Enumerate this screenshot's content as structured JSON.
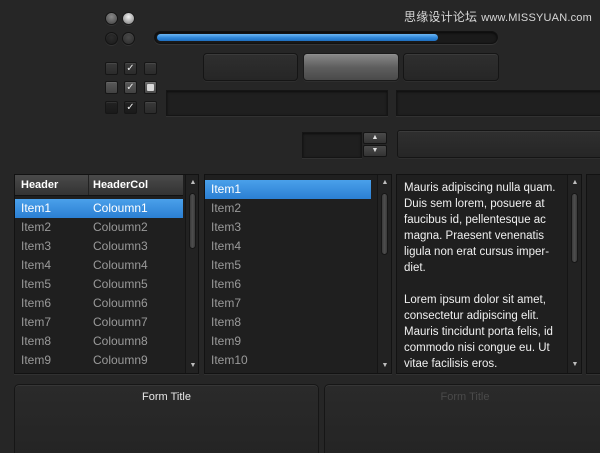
{
  "watermark": {
    "cn": "思缘设计论坛",
    "site": "www.MISSYUAN.com"
  },
  "progress": {
    "value": 0.83
  },
  "icons": {
    "check": "✓",
    "up": "▲",
    "down": "▼"
  },
  "table": {
    "headers": [
      "Header",
      "HeaderCol"
    ],
    "rows": [
      [
        "Item1",
        "Coloumn1"
      ],
      [
        "Item2",
        "Coloumn2"
      ],
      [
        "Item3",
        "Coloumn3"
      ],
      [
        "Item4",
        "Coloumn4"
      ],
      [
        "Item5",
        "Coloumn5"
      ],
      [
        "Item6",
        "Coloumn6"
      ],
      [
        "Item7",
        "Coloumn7"
      ],
      [
        "Item8",
        "Coloumn8"
      ],
      [
        "Item9",
        "Coloumn9"
      ]
    ],
    "selected_index": 0
  },
  "list": {
    "items": [
      "Item1",
      "Item2",
      "Item3",
      "Item4",
      "Item5",
      "Item6",
      "Item7",
      "Item8",
      "Item9",
      "Item10"
    ],
    "selected_index": 0
  },
  "textarea": {
    "paragraph1": "Mauris adipiscing nulla quam. Duis sem lorem, posuere at faucibus id, pellentesque ac magna. Praesent venenatis ligula non erat cursus imper-diet.",
    "paragraph2": "Lorem ipsum dolor sit amet, consectetur adipiscing elit. Mauris tincidunt porta felis, id commodo nisi congue eu. Ut vitae facilisis eros."
  },
  "forms": {
    "form1_title": "Form Title",
    "form2_title": "Form Title"
  },
  "colors": {
    "accent": "#2f86d8",
    "background": "#262626"
  }
}
